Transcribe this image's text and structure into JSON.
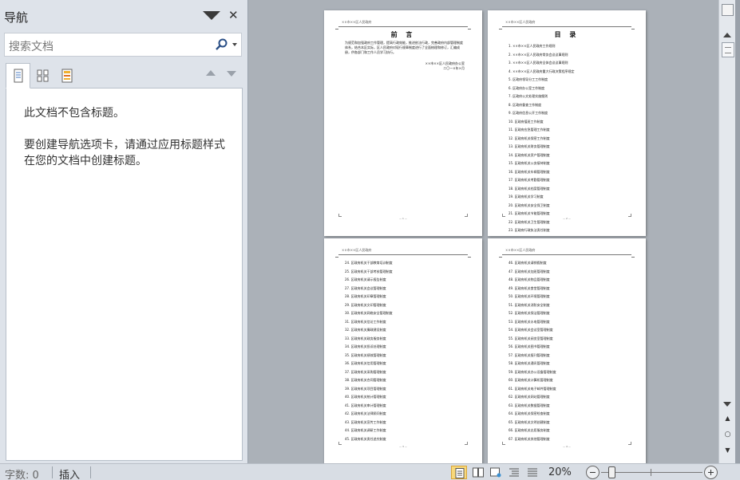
{
  "nav": {
    "title": "导航",
    "search_placeholder": "搜索文档",
    "message_no_headings": "此文档不包含标题。",
    "message_instructions": "要创建导航选项卡，请通过应用标题样式在您的文档中创建标题。"
  },
  "pages": [
    {
      "header": "××市××区人民政府",
      "title": "前 言",
      "body": "为规范和加强政府工作管理，提高行政效能，推进依法行政，完善政府内部管理制度体系，结合本区实际，区人民政府对现行规章制度进行了全面梳理和修订，汇编成册，供各部门和工作人员学习执行。",
      "signature": "××市××区人民政府办公室",
      "date": "二〇一×年×月",
      "footer": "— 1 —"
    },
    {
      "header": "××市××区人民政府",
      "title": "目 录",
      "toc": [
        "1. ××市××区人民政府工作规则",
        "2. ××市××区人民政府常务会议议事规则",
        "3. ××市××区人民政府全体会议议事规则",
        "4. ××市××区人民政府重大行政决策程序规定",
        "5. 区政府领导分工工作制度",
        "6. 区政府办公室工作制度",
        "7. 区政府公文处理实施细则",
        "8. 区政府督查工作制度",
        "9. 区政府信息公开工作制度",
        "10. 区政府值班工作制度",
        "11. 区政府应急管理工作制度",
        "12. 区政府机关保密工作制度",
        "13. 区政府机关财务管理制度",
        "14. 区政府机关资产管理制度",
        "15. 区政府机关公务接待制度",
        "16. 区政府机关车辆管理制度",
        "17. 区政府机关考勤管理制度",
        "18. 区政府机关档案管理制度",
        "19. 区政府机关学习制度",
        "20. 区政府机关安全保卫制度",
        "21. 区政府机关节能管理制度",
        "22. 区政府机关卫生管理制度",
        "23. 区政府行政执法责任制度"
      ],
      "footer": "— 2 —"
    },
    {
      "header": "××市××区人民政府",
      "toc": [
        "24. 区政府机关干部教育培训制度",
        "25. 区政府机关干部考核管理制度",
        "26. 区政府机关请示报告制度",
        "27. 区政府机关会议管理制度",
        "28. 区政府机关印章管理制度",
        "29. 区政府机关文印管理制度",
        "30. 区政府机关网络安全管理制度",
        "31. 区政府机关信访工作制度",
        "32. 区政府机关廉政建设制度",
        "33. 区政府机关政务服务制度",
        "34. 区政府机关投诉处理制度",
        "35. 区政府机关绩效管理制度",
        "36. 区政府机关信用管理制度",
        "37. 区政府机关采购管理制度",
        "38. 区政府机关合同管理制度",
        "39. 区政府机关项目管理制度",
        "40. 区政府机关统计管理制度",
        "41. 区政府机关审计管理制度",
        "42. 区政府机关法律顾问制度",
        "43. 区政府机关宣传工作制度",
        "44. 区政府机关调研工作制度",
        "45. 区政府机关责任追究制度"
      ],
      "footer": "— 3 —"
    },
    {
      "header": "××市××区人民政府",
      "toc": [
        "46. 区政府机关请销假制度",
        "47. 区政府机关加班管理制度",
        "48. 区政府机关物品管理制度",
        "49. 区政府机关食堂管理制度",
        "50. 区政府机关环境管理制度",
        "51. 区政府机关消防安全制度",
        "52. 区政府机关保洁管理制度",
        "53. 区政府机关水电管理制度",
        "54. 区政府机关会议室管理制度",
        "55. 区政府机关阅览室管理制度",
        "56. 区政府机关图书管理制度",
        "57. 区政府机关报刊管理制度",
        "58. 区政府机关通讯管理制度",
        "59. 区政府机关办公设备管理制度",
        "60. 区政府机关计算机管理制度",
        "61. 区政府机关电子邮件管理制度",
        "62. 区政府机关网站管理制度",
        "63. 区政府机关数据管理制度",
        "64. 区政府机关保密检查制度",
        "65. 区政府机关文明创建制度",
        "66. 区政府机关志愿服务制度",
        "67. 区政府机关其他管理制度"
      ],
      "footer": "— 4 —"
    }
  ],
  "status": {
    "word_count": "字数: 0",
    "insert_mode": "插入",
    "zoom": "20%",
    "zoom_value": 0.2
  },
  "colors": {
    "accent": "#f8d87a",
    "pane_bg": "#dee3ea",
    "doc_bg": "#abb1b8"
  }
}
